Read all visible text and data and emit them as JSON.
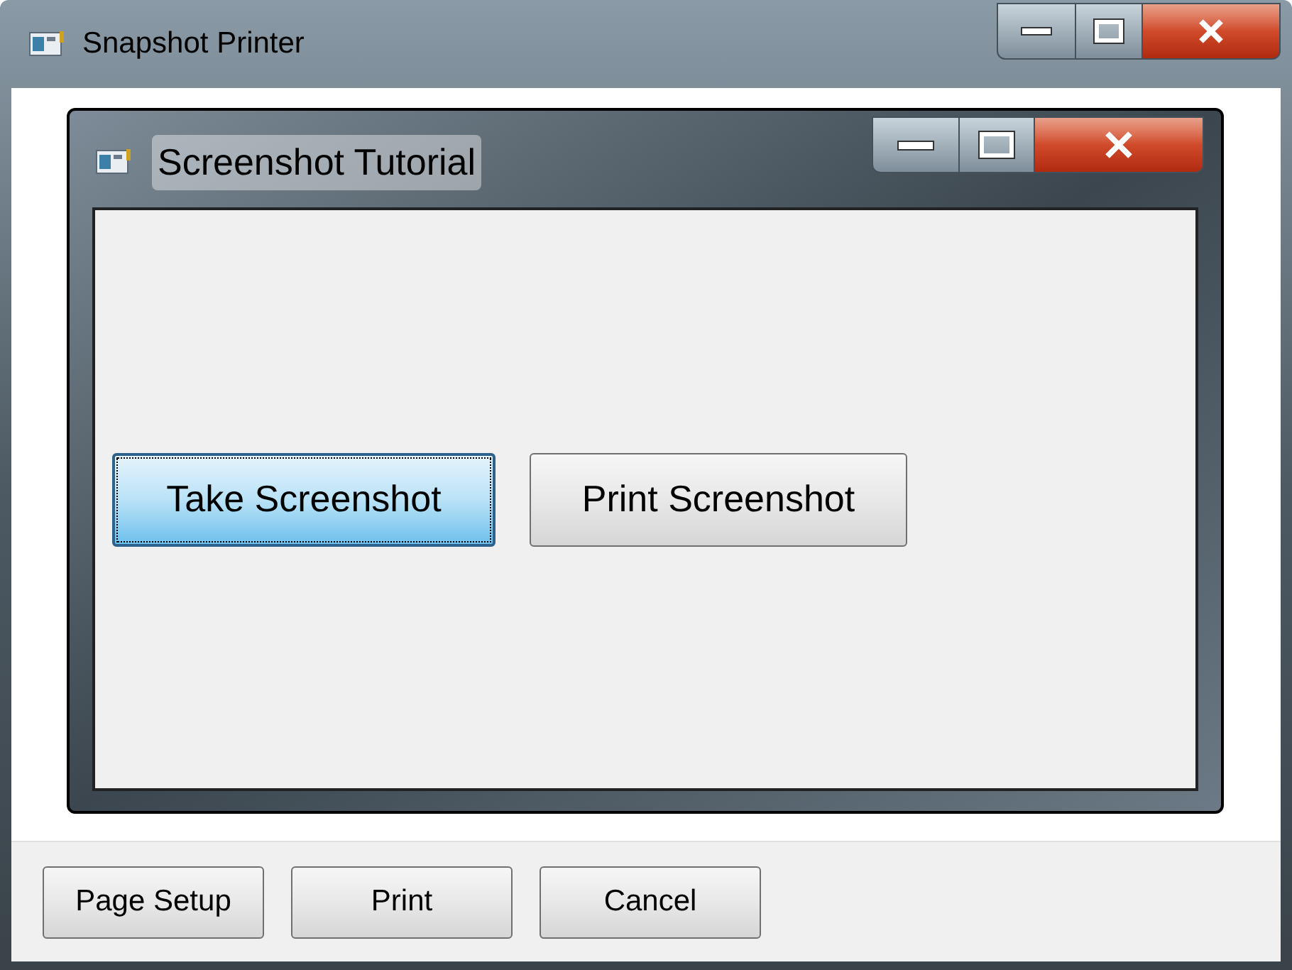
{
  "window": {
    "title": "Snapshot Printer"
  },
  "preview": {
    "window": {
      "title": "Screenshot Tutorial"
    },
    "buttons": [
      {
        "label": "Take Screenshot",
        "focused": true
      },
      {
        "label": "Print Screenshot",
        "focused": false
      }
    ]
  },
  "buttons": [
    "Page Setup",
    "Print",
    "Cancel"
  ]
}
